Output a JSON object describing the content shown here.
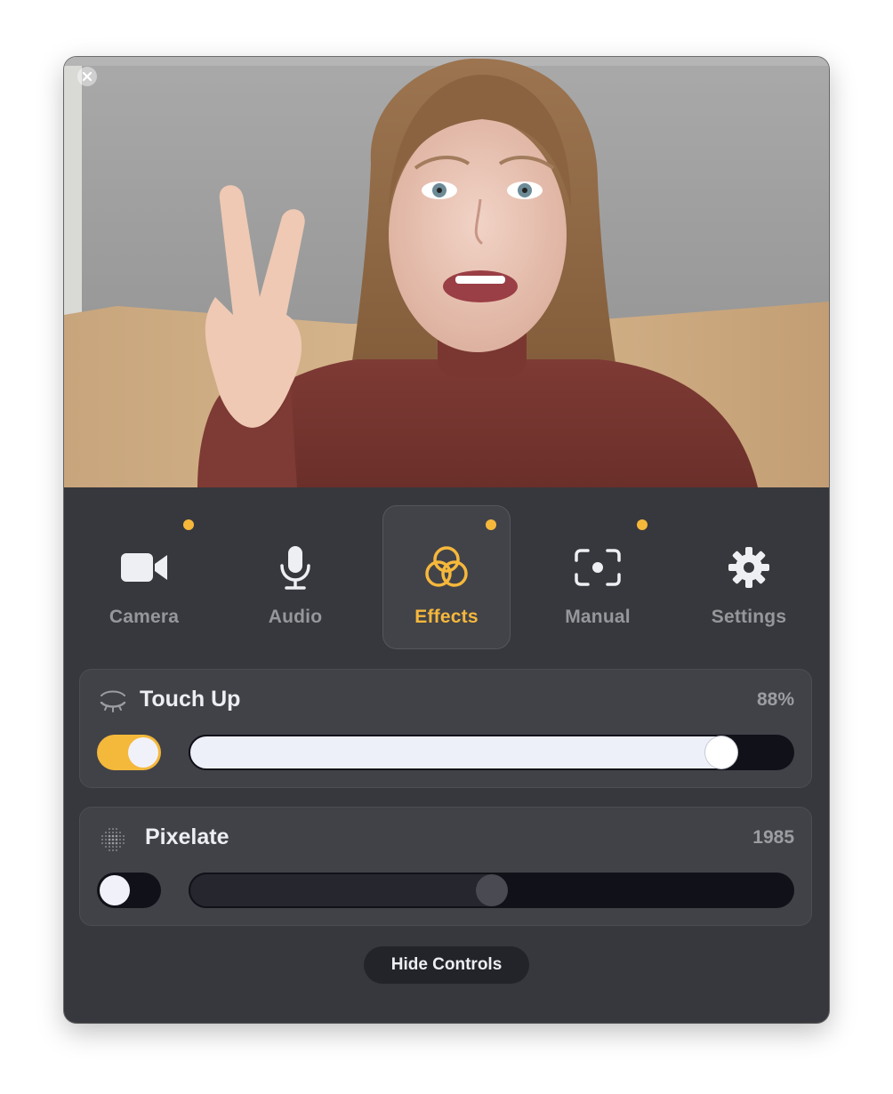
{
  "tabs": [
    {
      "label": "Camera",
      "icon": "video-camera-icon",
      "dot": true,
      "active": false
    },
    {
      "label": "Audio",
      "icon": "microphone-icon",
      "dot": false,
      "active": false
    },
    {
      "label": "Effects",
      "icon": "effects-circles-icon",
      "dot": true,
      "active": true
    },
    {
      "label": "Manual",
      "icon": "manual-focus-icon",
      "dot": true,
      "active": false
    },
    {
      "label": "Settings",
      "icon": "gear-icon",
      "dot": false,
      "active": false
    }
  ],
  "effects": {
    "touch_up": {
      "title": "Touch Up",
      "value_label": "88%",
      "enabled": true,
      "level": 0.88,
      "icon": "closed-eye-icon"
    },
    "pixelate": {
      "title": "Pixelate",
      "value_label": "1985",
      "enabled": false,
      "level": 0.5,
      "icon": "pixel-dots-icon"
    }
  },
  "hide_controls_label": "Hide Controls",
  "colors": {
    "accent": "#f6b83b",
    "panel_bg": "#37383d",
    "card_bg": "#414248",
    "track_dark": "#111219"
  }
}
